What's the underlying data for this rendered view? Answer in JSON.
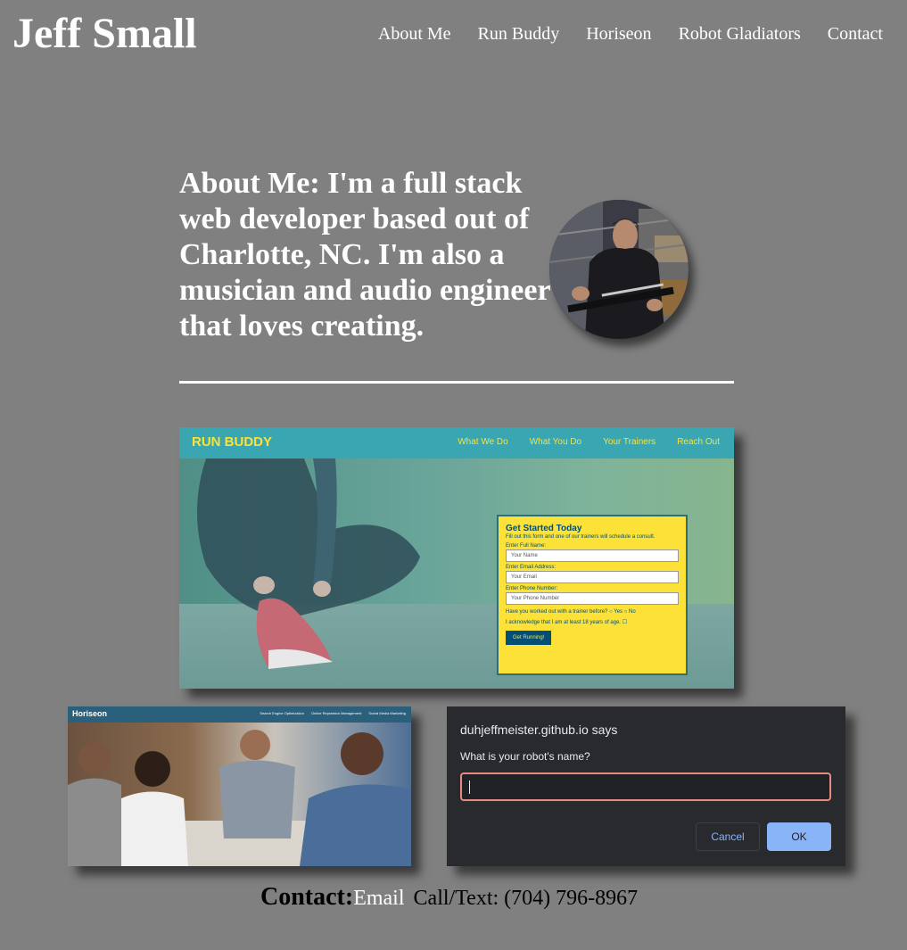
{
  "site": {
    "name": "Jeff Small"
  },
  "nav": [
    "About Me",
    "Run Buddy",
    "Horiseon",
    "Robot Gladiators",
    "Contact"
  ],
  "about": {
    "text": "About Me: I'm a full stack web developer based out of Charlotte, NC. I'm also a musician and audio engineer that loves creating."
  },
  "run_buddy": {
    "logo": "RUN BUDDY",
    "nav": [
      "What We Do",
      "What You Do",
      "Your Trainers",
      "Reach Out"
    ],
    "form": {
      "title": "Get Started Today",
      "subtitle": "Fill out this form and one of our trainers will schedule a consult.",
      "name_label": "Enter Full Name:",
      "name_placeholder": "Your Name",
      "email_label": "Enter Email Address:",
      "email_placeholder": "Your Email",
      "phone_label": "Enter Phone Number:",
      "phone_placeholder": "Your Phone Number",
      "trainer_question": "Have you worked out with a trainer before?",
      "yes": "Yes",
      "no": "No",
      "age_ack": "I acknowledge that I am at least 18 years of age.",
      "submit": "Get Running!"
    },
    "colors": {
      "header": "#39a6b2",
      "logo": "#fce138",
      "form": "#fce138",
      "button": "#024e76"
    }
  },
  "horiseon": {
    "logo": "Horiseon",
    "nav": [
      "Search Engine Optimization",
      "Online Reputation Management",
      "Social Media Marketing"
    ]
  },
  "robot_dialog": {
    "title": "duhjeffmeister.github.io says",
    "message": "What is your robot's name?",
    "cancel": "Cancel",
    "ok": "OK"
  },
  "contact": {
    "title": "Contact:",
    "email": "Email",
    "phone": "Call/Text: (704) 796-8967"
  }
}
